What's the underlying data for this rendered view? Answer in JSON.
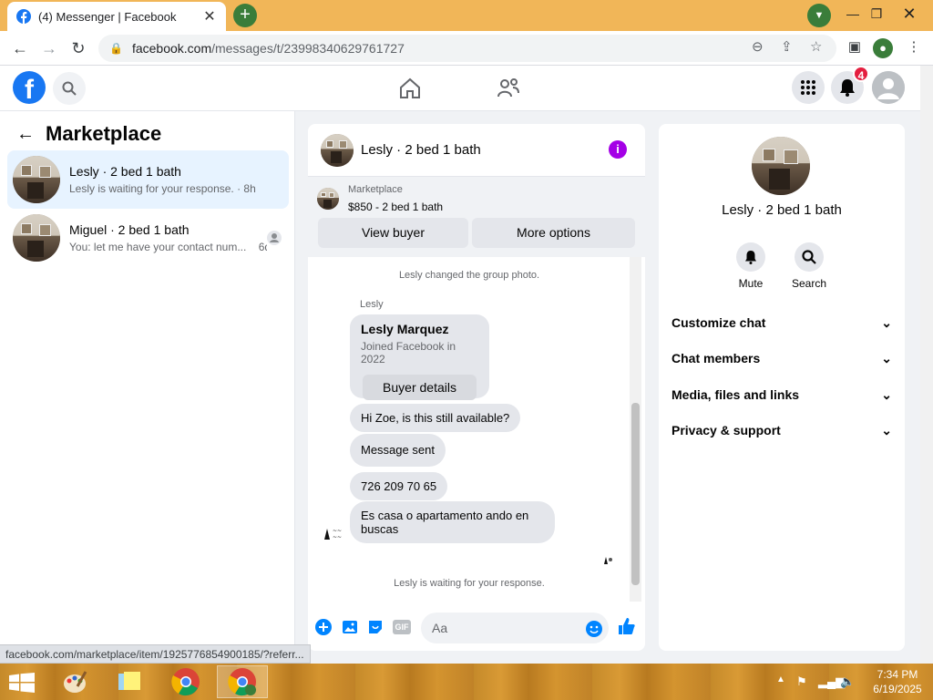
{
  "browser": {
    "tab_title": "(4) Messenger | Facebook",
    "tab_close": "✕",
    "new_tab": "+",
    "url_domain": "facebook.com",
    "url_path": "/messages/t/23998340629761727",
    "status_url": "facebook.com/marketplace/item/1925776854900185/?referr..."
  },
  "fb": {
    "notif_count": "4"
  },
  "left": {
    "title": "Marketplace",
    "conversations": [
      {
        "name": "Lesly · 2 bed 1 bath",
        "preview": "Lesly is waiting for your response. · 8h"
      },
      {
        "name": "Miguel · 2 bed 1 bath",
        "preview": "You: let me have your contact num...",
        "time": "6d"
      }
    ]
  },
  "chat": {
    "title": "Lesly · 2 bed 1 bath",
    "mp_label": "Marketplace",
    "mp_price": "$850 - 2 bed 1 bath",
    "view_buyer": "View buyer",
    "more_options": "More options",
    "sys_group_photo": "Lesly changed the group photo.",
    "sender_label": "Lesly",
    "card_name": "Lesly Marquez",
    "card_joined": "Joined Facebook in 2022",
    "card_button": "Buyer details",
    "msg1": "Hi Zoe, is this still available?",
    "msg2": "Message sent",
    "msg3": "726 209 70 65",
    "msg4": "Es casa o apartamento ando en buscas",
    "sys_waiting": "Lesly is waiting for your response.",
    "input_placeholder": "Aa",
    "gif": "GIF"
  },
  "right": {
    "name": "Lesly · 2 bed 1 bath",
    "mute": "Mute",
    "search": "Search",
    "sections": [
      "Customize chat",
      "Chat members",
      "Media, files and links",
      "Privacy & support"
    ]
  },
  "taskbar": {
    "time": "7:34 PM",
    "date": "6/19/2025"
  },
  "colors": {
    "fb_blue": "#1877f2",
    "tab_bar": "#f1b658",
    "active_conv": "#e7f3ff",
    "info_purple": "#a400e6"
  }
}
